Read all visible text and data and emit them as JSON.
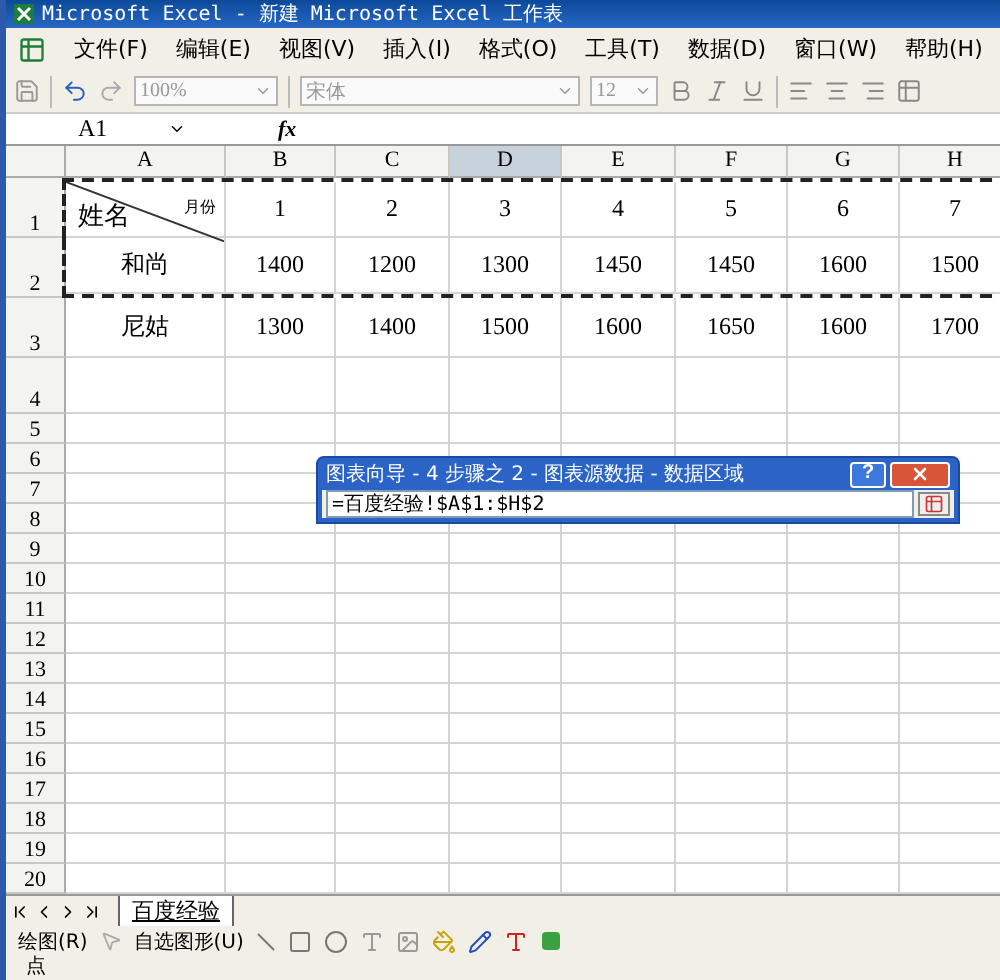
{
  "window": {
    "title": "Microsoft Excel - 新建 Microsoft Excel 工作表"
  },
  "menu": [
    "文件(F)",
    "编辑(E)",
    "视图(V)",
    "插入(I)",
    "格式(O)",
    "工具(T)",
    "数据(D)",
    "窗口(W)",
    "帮助(H)"
  ],
  "toolbar": {
    "zoom": "100%",
    "font": "宋体",
    "size": "12"
  },
  "formula_bar": {
    "name_box": "A1",
    "fx": "fx"
  },
  "columns": [
    {
      "label": "A",
      "selected": false
    },
    {
      "label": "B",
      "selected": false
    },
    {
      "label": "C",
      "selected": false
    },
    {
      "label": "D",
      "selected": true
    },
    {
      "label": "E",
      "selected": false
    },
    {
      "label": "F",
      "selected": false
    },
    {
      "label": "G",
      "selected": false
    },
    {
      "label": "H",
      "selected": false
    }
  ],
  "rows": [
    {
      "label": "1",
      "marked": true,
      "corner": {
        "top_right": "月份",
        "bottom_left": "姓名"
      },
      "cells": [
        "1",
        "2",
        "3",
        "4",
        "5",
        "6",
        "7"
      ]
    },
    {
      "label": "2",
      "marked": true,
      "cells": [
        "和尚",
        "1400",
        "1200",
        "1300",
        "1450",
        "1450",
        "1600",
        "1500"
      ]
    },
    {
      "label": "3",
      "marked": false,
      "cells": [
        "尼姑",
        "1300",
        "1400",
        "1500",
        "1600",
        "1650",
        "1600",
        "1700"
      ]
    },
    {
      "label": "4"
    },
    {
      "label": "5"
    },
    {
      "label": "6"
    },
    {
      "label": "7"
    },
    {
      "label": "8"
    },
    {
      "label": "9"
    },
    {
      "label": "10"
    },
    {
      "label": "11"
    },
    {
      "label": "12"
    },
    {
      "label": "13"
    },
    {
      "label": "14"
    },
    {
      "label": "15"
    },
    {
      "label": "16"
    },
    {
      "label": "17"
    },
    {
      "label": "18"
    },
    {
      "label": "19"
    },
    {
      "label": "20"
    }
  ],
  "dialog": {
    "title": "图表向导 - 4 步骤之 2 - 图表源数据 - 数据区域",
    "help": "?",
    "value": "=百度经验!$A$1:$H$2"
  },
  "sheet_tabs": [
    {
      "label": "百度经验",
      "selected": true
    }
  ],
  "drawing_toolbar": {
    "draw": "绘图(R)",
    "autoshapes": "自选图形(U)"
  },
  "status_bar": "点"
}
